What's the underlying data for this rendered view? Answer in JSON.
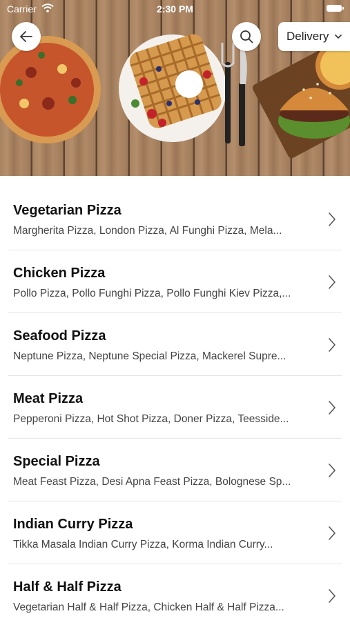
{
  "status_bar": {
    "carrier": "Carrier",
    "time": "2:30 PM"
  },
  "header": {
    "delivery_label": "Delivery"
  },
  "icons": {
    "back": "arrow-left-icon",
    "search": "search-icon",
    "dropdown": "chevron-down-icon",
    "row": "chevron-right-icon"
  },
  "colors": {
    "text": "#111111",
    "subtext": "#444444",
    "divider": "#e6e6e6"
  },
  "categories": [
    {
      "title": "Vegetarian Pizza",
      "subtitle": "Margherita Pizza, London Pizza, Al Funghi Pizza, Mela..."
    },
    {
      "title": "Chicken Pizza",
      "subtitle": "Pollo Pizza, Pollo Funghi Pizza, Pollo Funghi Kiev Pizza,..."
    },
    {
      "title": "Seafood Pizza",
      "subtitle": "Neptune Pizza, Neptune Special Pizza, Mackerel Supre..."
    },
    {
      "title": "Meat Pizza",
      "subtitle": "Pepperoni Pizza, Hot Shot Pizza, Doner Pizza, Teesside..."
    },
    {
      "title": "Special Pizza",
      "subtitle": "Meat Feast Pizza, Desi Apna Feast Pizza, Bolognese Sp..."
    },
    {
      "title": "Indian Curry Pizza",
      "subtitle": "Tikka Masala Indian Curry Pizza, Korma Indian Curry..."
    },
    {
      "title": "Half & Half Pizza",
      "subtitle": "Vegetarian Half & Half Pizza, Chicken Half & Half Pizza..."
    }
  ]
}
